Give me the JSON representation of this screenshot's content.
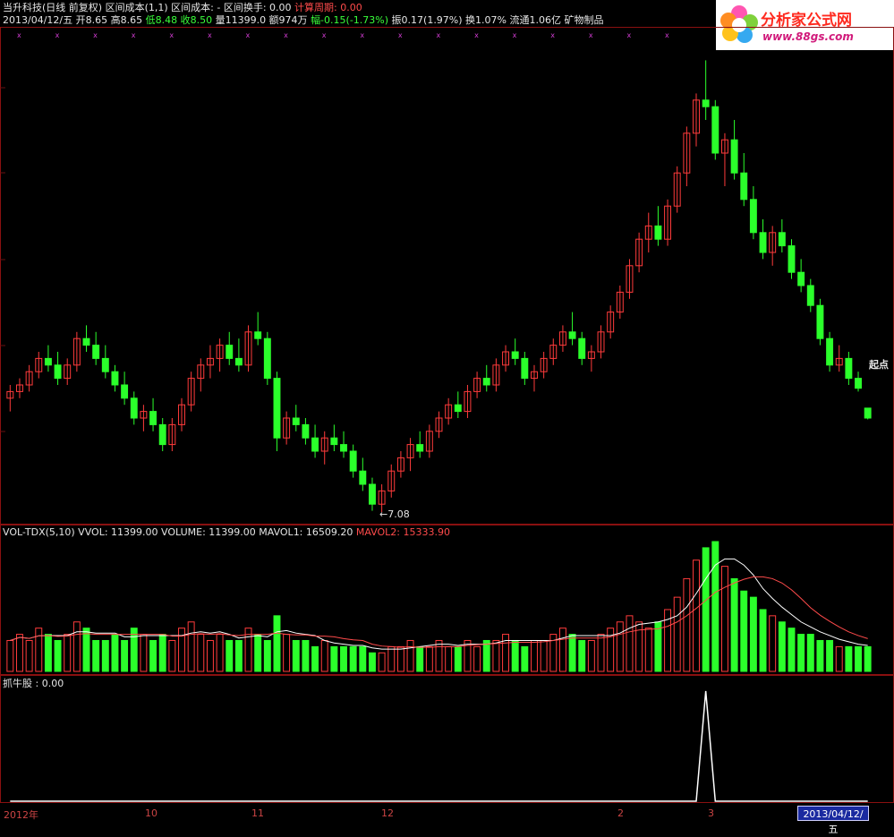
{
  "header": {
    "line1": [
      {
        "text": "当升科技(日线 前复权) 区间成本(1,1) 区间成本: - 区间换手: 0.00 ",
        "color": "#e6e6e6"
      },
      {
        "text": "计算周期: 0.00",
        "color": "#ff4b4b"
      }
    ],
    "line2": [
      {
        "text": "2013/04/12/五 ",
        "color": "#e6e6e6"
      },
      {
        "text": "开8.65 高8.65 ",
        "color": "#e6e6e6"
      },
      {
        "text": "低8.48 收8.50 ",
        "color": "#39ff3a"
      },
      {
        "text": "量11399.0 额974万 ",
        "color": "#e6e6e6"
      },
      {
        "text": "幅-0.15(-1.73%) ",
        "color": "#39ff3a"
      },
      {
        "text": "振0.17(1.97%) 换1.07% 流通1.06亿 矿物制品",
        "color": "#e6e6e6"
      }
    ],
    "markers": "x"
  },
  "logo": {
    "brand": "分析家公式网",
    "url": "www.88gs.com"
  },
  "price_panel": {
    "low_label": "←7.08",
    "signal_label": "起点"
  },
  "volume_panel": {
    "title": "VOL-TDX(5,10) VVOL: 11399.00  VOLUME: 11399.00  MAVOL1: 16509.20 ",
    "mavol2": "MAVOL2: 15333.90"
  },
  "indicator_panel": {
    "title": "抓牛股 : 0.00"
  },
  "axis": {
    "labels": [
      {
        "text": "2012年"
      },
      {
        "text": "10"
      },
      {
        "text": "11"
      },
      {
        "text": "12"
      },
      {
        "text": "2"
      },
      {
        "text": "3"
      }
    ],
    "current_date": "2013/04/12/五"
  },
  "colors": {
    "up": "#ff3b3b",
    "down": "#2bff2b",
    "border": "#8a1010",
    "grid": "#6a1010"
  },
  "chart_data": {
    "type": "candlestick",
    "series": [
      {
        "name": "price",
        "values": [
          {
            "o": 8.8,
            "h": 9.0,
            "l": 8.6,
            "c": 8.9
          },
          {
            "o": 8.9,
            "h": 9.1,
            "l": 8.8,
            "c": 9.0
          },
          {
            "o": 9.0,
            "h": 9.3,
            "l": 8.9,
            "c": 9.2
          },
          {
            "o": 9.2,
            "h": 9.5,
            "l": 9.1,
            "c": 9.4
          },
          {
            "o": 9.4,
            "h": 9.6,
            "l": 9.2,
            "c": 9.3
          },
          {
            "o": 9.3,
            "h": 9.5,
            "l": 9.0,
            "c": 9.1
          },
          {
            "o": 9.1,
            "h": 9.4,
            "l": 9.0,
            "c": 9.3
          },
          {
            "o": 9.3,
            "h": 9.8,
            "l": 9.2,
            "c": 9.7
          },
          {
            "o": 9.7,
            "h": 9.9,
            "l": 9.5,
            "c": 9.6
          },
          {
            "o": 9.6,
            "h": 9.8,
            "l": 9.3,
            "c": 9.4
          },
          {
            "o": 9.4,
            "h": 9.6,
            "l": 9.1,
            "c": 9.2
          },
          {
            "o": 9.2,
            "h": 9.3,
            "l": 8.9,
            "c": 9.0
          },
          {
            "o": 9.0,
            "h": 9.2,
            "l": 8.7,
            "c": 8.8
          },
          {
            "o": 8.8,
            "h": 8.9,
            "l": 8.4,
            "c": 8.5
          },
          {
            "o": 8.5,
            "h": 8.7,
            "l": 8.3,
            "c": 8.6
          },
          {
            "o": 8.6,
            "h": 8.8,
            "l": 8.3,
            "c": 8.4
          },
          {
            "o": 8.4,
            "h": 8.5,
            "l": 8.0,
            "c": 8.1
          },
          {
            "o": 8.1,
            "h": 8.5,
            "l": 8.0,
            "c": 8.4
          },
          {
            "o": 8.4,
            "h": 8.8,
            "l": 8.3,
            "c": 8.7
          },
          {
            "o": 8.7,
            "h": 9.2,
            "l": 8.6,
            "c": 9.1
          },
          {
            "o": 9.1,
            "h": 9.4,
            "l": 8.9,
            "c": 9.3
          },
          {
            "o": 9.3,
            "h": 9.6,
            "l": 9.1,
            "c": 9.4
          },
          {
            "o": 9.4,
            "h": 9.7,
            "l": 9.2,
            "c": 9.6
          },
          {
            "o": 9.6,
            "h": 9.8,
            "l": 9.3,
            "c": 9.4
          },
          {
            "o": 9.4,
            "h": 9.7,
            "l": 9.2,
            "c": 9.3
          },
          {
            "o": 9.3,
            "h": 9.9,
            "l": 9.2,
            "c": 9.8
          },
          {
            "o": 9.8,
            "h": 10.1,
            "l": 9.6,
            "c": 9.7
          },
          {
            "o": 9.7,
            "h": 9.8,
            "l": 9.0,
            "c": 9.1
          },
          {
            "o": 9.1,
            "h": 9.2,
            "l": 8.0,
            "c": 8.2
          },
          {
            "o": 8.2,
            "h": 8.6,
            "l": 8.1,
            "c": 8.5
          },
          {
            "o": 8.5,
            "h": 8.7,
            "l": 8.3,
            "c": 8.4
          },
          {
            "o": 8.4,
            "h": 8.5,
            "l": 8.1,
            "c": 8.2
          },
          {
            "o": 8.2,
            "h": 8.4,
            "l": 7.9,
            "c": 8.0
          },
          {
            "o": 8.0,
            "h": 8.3,
            "l": 7.8,
            "c": 8.2
          },
          {
            "o": 8.2,
            "h": 8.4,
            "l": 8.0,
            "c": 8.1
          },
          {
            "o": 8.1,
            "h": 8.3,
            "l": 7.9,
            "c": 8.0
          },
          {
            "o": 8.0,
            "h": 8.1,
            "l": 7.6,
            "c": 7.7
          },
          {
            "o": 7.7,
            "h": 7.9,
            "l": 7.4,
            "c": 7.5
          },
          {
            "o": 7.5,
            "h": 7.6,
            "l": 7.1,
            "c": 7.2
          },
          {
            "o": 7.2,
            "h": 7.5,
            "l": 7.08,
            "c": 7.4
          },
          {
            "o": 7.4,
            "h": 7.8,
            "l": 7.3,
            "c": 7.7
          },
          {
            "o": 7.7,
            "h": 8.0,
            "l": 7.6,
            "c": 7.9
          },
          {
            "o": 7.9,
            "h": 8.2,
            "l": 7.7,
            "c": 8.1
          },
          {
            "o": 8.1,
            "h": 8.3,
            "l": 7.9,
            "c": 8.0
          },
          {
            "o": 8.0,
            "h": 8.4,
            "l": 7.9,
            "c": 8.3
          },
          {
            "o": 8.3,
            "h": 8.6,
            "l": 8.2,
            "c": 8.5
          },
          {
            "o": 8.5,
            "h": 8.8,
            "l": 8.4,
            "c": 8.7
          },
          {
            "o": 8.7,
            "h": 8.9,
            "l": 8.5,
            "c": 8.6
          },
          {
            "o": 8.6,
            "h": 9.0,
            "l": 8.5,
            "c": 8.9
          },
          {
            "o": 8.9,
            "h": 9.2,
            "l": 8.8,
            "c": 9.1
          },
          {
            "o": 9.1,
            "h": 9.3,
            "l": 8.9,
            "c": 9.0
          },
          {
            "o": 9.0,
            "h": 9.4,
            "l": 8.9,
            "c": 9.3
          },
          {
            "o": 9.3,
            "h": 9.6,
            "l": 9.2,
            "c": 9.5
          },
          {
            "o": 9.5,
            "h": 9.7,
            "l": 9.3,
            "c": 9.4
          },
          {
            "o": 9.4,
            "h": 9.5,
            "l": 9.0,
            "c": 9.1
          },
          {
            "o": 9.1,
            "h": 9.3,
            "l": 8.9,
            "c": 9.2
          },
          {
            "o": 9.2,
            "h": 9.5,
            "l": 9.1,
            "c": 9.4
          },
          {
            "o": 9.4,
            "h": 9.7,
            "l": 9.3,
            "c": 9.6
          },
          {
            "o": 9.6,
            "h": 9.9,
            "l": 9.5,
            "c": 9.8
          },
          {
            "o": 9.8,
            "h": 10.1,
            "l": 9.6,
            "c": 9.7
          },
          {
            "o": 9.7,
            "h": 9.8,
            "l": 9.3,
            "c": 9.4
          },
          {
            "o": 9.4,
            "h": 9.6,
            "l": 9.2,
            "c": 9.5
          },
          {
            "o": 9.5,
            "h": 9.9,
            "l": 9.4,
            "c": 9.8
          },
          {
            "o": 9.8,
            "h": 10.2,
            "l": 9.7,
            "c": 10.1
          },
          {
            "o": 10.1,
            "h": 10.5,
            "l": 10.0,
            "c": 10.4
          },
          {
            "o": 10.4,
            "h": 10.9,
            "l": 10.3,
            "c": 10.8
          },
          {
            "o": 10.8,
            "h": 11.3,
            "l": 10.7,
            "c": 11.2
          },
          {
            "o": 11.2,
            "h": 11.6,
            "l": 11.0,
            "c": 11.4
          },
          {
            "o": 11.4,
            "h": 11.7,
            "l": 11.1,
            "c": 11.2
          },
          {
            "o": 11.2,
            "h": 11.8,
            "l": 11.1,
            "c": 11.7
          },
          {
            "o": 11.7,
            "h": 12.3,
            "l": 11.6,
            "c": 12.2
          },
          {
            "o": 12.2,
            "h": 12.9,
            "l": 12.0,
            "c": 12.8
          },
          {
            "o": 12.8,
            "h": 13.4,
            "l": 12.6,
            "c": 13.3
          },
          {
            "o": 13.3,
            "h": 13.9,
            "l": 13.0,
            "c": 13.2
          },
          {
            "o": 13.2,
            "h": 13.3,
            "l": 12.4,
            "c": 12.5
          },
          {
            "o": 12.5,
            "h": 12.8,
            "l": 12.0,
            "c": 12.7
          },
          {
            "o": 12.7,
            "h": 13.0,
            "l": 12.1,
            "c": 12.2
          },
          {
            "o": 12.2,
            "h": 12.5,
            "l": 11.7,
            "c": 11.8
          },
          {
            "o": 11.8,
            "h": 12.0,
            "l": 11.2,
            "c": 11.3
          },
          {
            "o": 11.3,
            "h": 11.5,
            "l": 10.9,
            "c": 11.0
          },
          {
            "o": 11.0,
            "h": 11.4,
            "l": 10.8,
            "c": 11.3
          },
          {
            "o": 11.3,
            "h": 11.5,
            "l": 11.0,
            "c": 11.1
          },
          {
            "o": 11.1,
            "h": 11.2,
            "l": 10.6,
            "c": 10.7
          },
          {
            "o": 10.7,
            "h": 10.9,
            "l": 10.4,
            "c": 10.5
          },
          {
            "o": 10.5,
            "h": 10.6,
            "l": 10.1,
            "c": 10.2
          },
          {
            "o": 10.2,
            "h": 10.3,
            "l": 9.6,
            "c": 9.7
          },
          {
            "o": 9.7,
            "h": 9.8,
            "l": 9.2,
            "c": 9.3
          },
          {
            "o": 9.3,
            "h": 9.6,
            "l": 9.2,
            "c": 9.4
          },
          {
            "o": 9.4,
            "h": 9.5,
            "l": 9.0,
            "c": 9.1
          },
          {
            "o": 9.1,
            "h": 9.2,
            "l": 8.9,
            "c": 8.95
          },
          {
            "o": 8.65,
            "h": 8.65,
            "l": 8.48,
            "c": 8.5
          }
        ]
      },
      {
        "name": "volume",
        "values": [
          5,
          6,
          5,
          7,
          6,
          5,
          6,
          8,
          7,
          5,
          5,
          6,
          5,
          7,
          6,
          5,
          6,
          5,
          7,
          8,
          6,
          5,
          6,
          5,
          5,
          7,
          6,
          5,
          9,
          6,
          5,
          5,
          4,
          5,
          4,
          4,
          4,
          4,
          3,
          3,
          4,
          4,
          5,
          4,
          4,
          5,
          4,
          4,
          5,
          4,
          5,
          5,
          6,
          5,
          4,
          5,
          5,
          6,
          7,
          6,
          5,
          5,
          6,
          7,
          8,
          9,
          8,
          7,
          8,
          10,
          12,
          15,
          18,
          20,
          21,
          17,
          15,
          13,
          12,
          10,
          9,
          8,
          7,
          6,
          6,
          5,
          5,
          4,
          4,
          4,
          4
        ]
      },
      {
        "name": "signal",
        "values": [
          0,
          0,
          0,
          0,
          0,
          0,
          0,
          0,
          0,
          0,
          0,
          0,
          0,
          0,
          0,
          0,
          0,
          0,
          0,
          0,
          0,
          0,
          0,
          0,
          0,
          0,
          0,
          0,
          0,
          0,
          0,
          0,
          0,
          0,
          0,
          0,
          0,
          0,
          0,
          0,
          0,
          0,
          0,
          0,
          0,
          0,
          0,
          0,
          0,
          0,
          0,
          0,
          0,
          0,
          0,
          0,
          0,
          0,
          0,
          0,
          0,
          0,
          0,
          0,
          0,
          0,
          0,
          0,
          0,
          0,
          0,
          0,
          0,
          1,
          0,
          0,
          0,
          0,
          0,
          0,
          0,
          0,
          0,
          0,
          0,
          0,
          0,
          0,
          0,
          0,
          0
        ]
      }
    ],
    "ylim": [
      7.0,
      14.0
    ]
  }
}
